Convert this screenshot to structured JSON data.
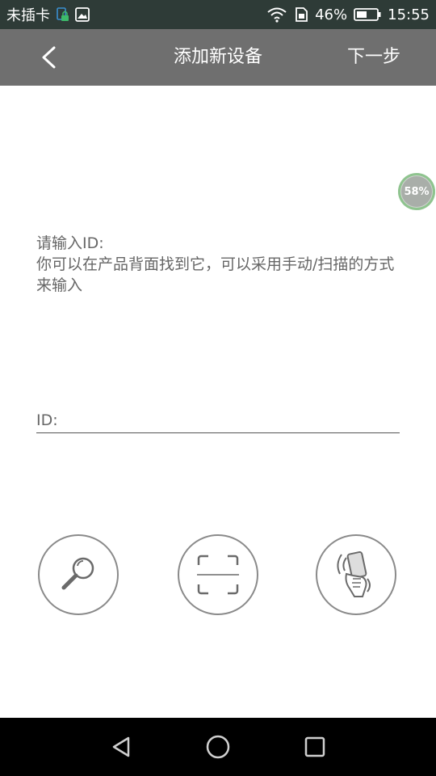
{
  "status_bar": {
    "carrier": "未插卡",
    "battery_percent": "46%",
    "time": "15:55",
    "icons": [
      "sim-lock-icon",
      "gallery-icon",
      "wifi-icon",
      "sim-card-icon",
      "battery-icon"
    ]
  },
  "header": {
    "title": "添加新设备",
    "next_label": "下一步",
    "back_icon": "chevron-left-icon"
  },
  "floating_badge": {
    "label": "58%"
  },
  "instruction": {
    "line1": "请输入ID:",
    "line2": "你可以在产品背面找到它，可以采用手动/扫描的方式来输入"
  },
  "id_field": {
    "label": "ID:",
    "value": ""
  },
  "actions": [
    {
      "icon": "search-icon"
    },
    {
      "icon": "scan-icon"
    },
    {
      "icon": "shake-phone-icon"
    }
  ],
  "navigation": {
    "icons": [
      "back-triangle-icon",
      "home-circle-icon",
      "recents-square-icon"
    ]
  },
  "colors": {
    "status_bar": "#2e3b37",
    "title_bar": "#6f6f6f",
    "text_gray": "#666666",
    "nav_bar": "#000000",
    "badge_ring": "#8fc48f"
  }
}
